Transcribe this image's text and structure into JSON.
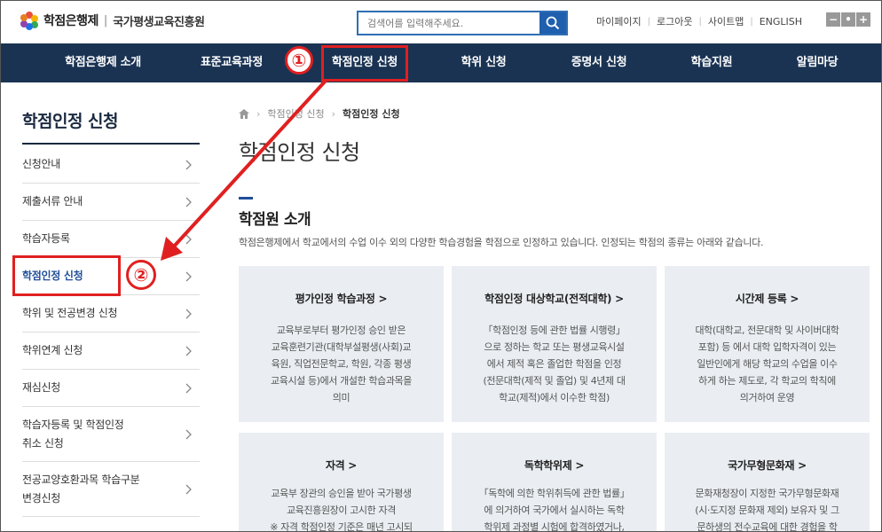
{
  "header": {
    "logo_name": "학점은행제",
    "logo_separator": "|",
    "logo_org": "국가평생교육진흥원",
    "search_placeholder": "검색어를 입력해주세요.",
    "util_links": [
      "마이페이지",
      "로그아웃",
      "사이트맵",
      "ENGLISH"
    ],
    "zoom_buttons": [
      "−",
      "•",
      "+"
    ]
  },
  "gnb": {
    "items": [
      "학점은행제 소개",
      "표준교육과정",
      "학점인정 신청",
      "학위 신청",
      "증명서 신청",
      "학습지원",
      "알림마당"
    ],
    "highlight_color": "#e02020"
  },
  "sidebar": {
    "title": "학점인정 신청",
    "items": [
      {
        "label": "신청안내"
      },
      {
        "label": "제출서류 안내"
      },
      {
        "label": "학습자등록"
      },
      {
        "label": "학점인정 신청"
      },
      {
        "label": "학위 및 전공변경 신청"
      },
      {
        "label": "학위연계 신청"
      },
      {
        "label": "재심신청"
      },
      {
        "label": "학습자등록 및 학점인정\n취소 신청"
      },
      {
        "label": "전공교양호환과목 학습구분\n변경신청"
      }
    ]
  },
  "annotations": {
    "step1": "①",
    "step2": "②"
  },
  "breadcrumb": {
    "items": [
      "학점인정 신청",
      "학점인정 신청"
    ]
  },
  "main": {
    "page_title": "학점인정 신청",
    "section_title": "학점원 소개",
    "section_desc": "학점은행제에서 학교에서의 수업 이수 외의 다양한 학습경험을 학점으로 인정하고 있습니다. 인정되는 학점의 종류는 아래와 같습니다.",
    "cards": [
      {
        "title": "평가인정 학습과정 >",
        "desc": "교육부로부터 평가인정 승인 받은\n교육훈련기관(대학부설평생(사회)교\n육원, 직업전문학교, 학원, 각종 평생\n교육시설 등)에서 개설한 학습과목을\n의미"
      },
      {
        "title": "학점인정 대상학교(전적대학) >",
        "desc": "「학점인정 등에 관한 법률 시행령」\n으로 정하는 학교 또는 평생교육시설\n에서 제적 혹은 졸업한 학점을 인정\n(전문대학(제적 및 졸업) 및 4년제 대\n학교(제적)에서 이수한 학점)"
      },
      {
        "title": "시간제 등록 >",
        "desc": "대학(대학교, 전문대학 및 사이버대학\n포함) 등 에서 대학 입학자격이 있는\n일반인에게 해당 학교의 수업을 이수\n하게 하는 제도로, 각 학교의 학칙에\n의거하여 운영"
      },
      {
        "title": "자격 >",
        "desc": "교육부 장관의 승인을 받아 국가평생\n교육진흥원장이 고시한 자격\n※ 자격 학점인정 기준은 매년 고시되"
      },
      {
        "title": "독학학위제 >",
        "desc": "「독학에 의한 학위취득에 관한 법률」\n에 의거하여 국가에서 실시하는 독학\n학위제 과정별 시험에 합격하였거나,"
      },
      {
        "title": "국가무형문화재 >",
        "desc": "문화재청장이 지정한 국가무형문화재\n(시·도지정 문화재 제외) 보유자 및 그\n문하생의 전수교육에 대한 경험을 학"
      }
    ]
  },
  "colors": {
    "gnb_bg": "#1a3353",
    "card_bg": "#eaeef2",
    "accent_red": "#e02020",
    "accent_blue": "#1f5fae"
  }
}
